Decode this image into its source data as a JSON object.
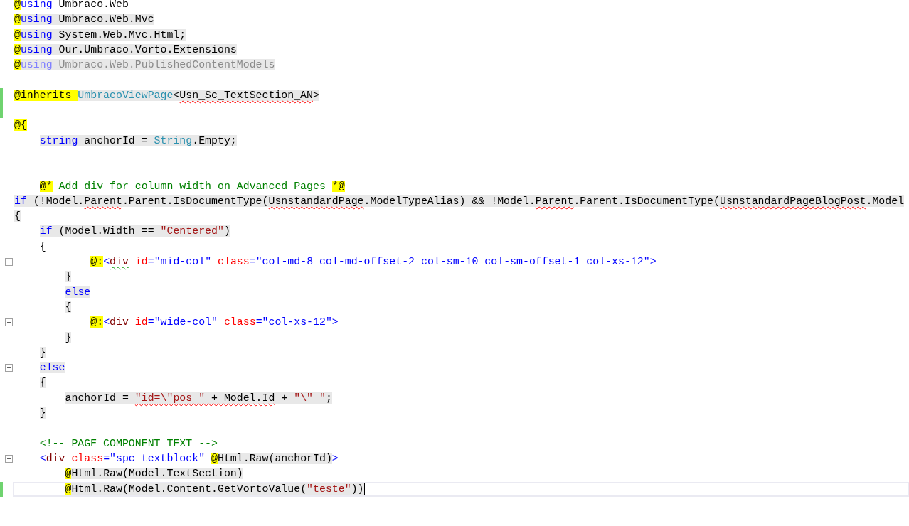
{
  "editor": {
    "lines": [
      {
        "kind": "code",
        "tokens": [
          {
            "kind": "razor",
            "text": "@"
          },
          {
            "kind": "keyword",
            "text": "using"
          },
          {
            "kind": "plain",
            "text": " Umbraco.Web"
          }
        ]
      },
      {
        "kind": "code",
        "tokens": [
          {
            "kind": "razor",
            "text": "@"
          },
          {
            "kind": "keyword",
            "text": "using",
            "hl": true
          },
          {
            "kind": "plain",
            "text": " Umbraco.Web.Mvc",
            "hl": true
          }
        ]
      },
      {
        "kind": "code",
        "tokens": [
          {
            "kind": "razor",
            "text": "@"
          },
          {
            "kind": "keyword",
            "text": "using",
            "hl": true
          },
          {
            "kind": "plain",
            "text": " System.Web.Mvc.Html;",
            "hl": true
          }
        ]
      },
      {
        "kind": "code",
        "tokens": [
          {
            "kind": "razor",
            "text": "@"
          },
          {
            "kind": "keyword",
            "text": "using",
            "hl": true
          },
          {
            "kind": "plain",
            "text": " Our.Umbraco.Vorto.Extensions",
            "hl": true
          }
        ]
      },
      {
        "kind": "code",
        "tokens": [
          {
            "kind": "razor",
            "text": "@"
          },
          {
            "kind": "fadedkeyword",
            "text": "using",
            "hl": true
          },
          {
            "kind": "faded",
            "text": " Umbraco.Web.PublishedContentModels",
            "hl": true
          }
        ]
      },
      {
        "kind": "blank"
      },
      {
        "kind": "code",
        "changed": true,
        "tokens": [
          {
            "kind": "razor",
            "text": "@inherits "
          },
          {
            "kind": "type",
            "text": "UmbracoViewPage",
            "hl": true
          },
          {
            "kind": "plain",
            "text": "<",
            "hl": true
          },
          {
            "kind": "plain",
            "text": "Usn_Sc_TextSection_AN",
            "hl": true,
            "error": true
          },
          {
            "kind": "plain",
            "text": ">",
            "hl": true
          }
        ]
      },
      {
        "kind": "blank",
        "changed": true
      },
      {
        "kind": "code",
        "tokens": [
          {
            "kind": "razor",
            "text": "@{"
          }
        ]
      },
      {
        "kind": "code",
        "tokens": [
          {
            "kind": "keyword",
            "text": "    string",
            "hl": true
          },
          {
            "kind": "plain",
            "text": " anchorId = ",
            "hl": true
          },
          {
            "kind": "type",
            "text": "String",
            "hl": true
          },
          {
            "kind": "plain",
            "text": ".Empty;",
            "hl": true
          }
        ]
      },
      {
        "kind": "blank"
      },
      {
        "kind": "blank"
      },
      {
        "kind": "code",
        "tokens": [
          {
            "kind": "razor",
            "text": "    @*"
          },
          {
            "kind": "comment",
            "text": " Add div for column width on Advanced Pages "
          },
          {
            "kind": "razor",
            "text": "*@"
          }
        ]
      },
      {
        "kind": "code",
        "tokens": [
          {
            "kind": "keyword",
            "text": "if",
            "hl": true
          },
          {
            "kind": "plain",
            "text": " (!Model.",
            "hl": true
          },
          {
            "kind": "plain",
            "text": "Parent",
            "hl": true,
            "error": true
          },
          {
            "kind": "plain",
            "text": ".Parent.IsDocumentType(",
            "hl": true
          },
          {
            "kind": "plain",
            "text": "UsnstandardPage",
            "hl": true,
            "error": true
          },
          {
            "kind": "plain",
            "text": ".ModelTypeAlias) && !Model.",
            "hl": true
          },
          {
            "kind": "plain",
            "text": "Parent",
            "hl": true,
            "error": true
          },
          {
            "kind": "plain",
            "text": ".Parent.IsDocumentType(",
            "hl": true
          },
          {
            "kind": "plain",
            "text": "UsnstandardPageBlogPost",
            "hl": true,
            "error": true
          },
          {
            "kind": "plain",
            "text": ".Model",
            "hl": true
          }
        ]
      },
      {
        "kind": "code",
        "tokens": [
          {
            "kind": "plain",
            "text": "{",
            "hl": true
          }
        ]
      },
      {
        "kind": "code",
        "tokens": [
          {
            "kind": "keyword",
            "text": "    if",
            "hl": true
          },
          {
            "kind": "plain",
            "text": " (Model.Width == ",
            "hl": true
          },
          {
            "kind": "string",
            "text": "\"Centered\"",
            "hl": true
          },
          {
            "kind": "plain",
            "text": ")",
            "hl": true
          }
        ]
      },
      {
        "kind": "code",
        "tokens": [
          {
            "kind": "plain",
            "text": "    {"
          }
        ]
      },
      {
        "kind": "code",
        "fold": true,
        "tokens": [
          {
            "kind": "razor",
            "text": "            @:"
          },
          {
            "kind": "tag",
            "text": "<"
          },
          {
            "kind": "element",
            "text": "div",
            "warning": true
          },
          {
            "kind": "attr",
            "text": " id"
          },
          {
            "kind": "tag",
            "text": "="
          },
          {
            "kind": "tag",
            "text": "\"mid-col\""
          },
          {
            "kind": "attr",
            "text": " class"
          },
          {
            "kind": "tag",
            "text": "="
          },
          {
            "kind": "tag",
            "text": "\"col-md-8 col-md-offset-2 col-sm-10 col-sm-offset-1 col-xs-12\""
          },
          {
            "kind": "tag",
            "text": ">"
          }
        ]
      },
      {
        "kind": "code",
        "tokens": [
          {
            "kind": "plain",
            "text": "        }",
            "hl": true
          }
        ]
      },
      {
        "kind": "code",
        "tokens": [
          {
            "kind": "keyword",
            "text": "        else",
            "hl": true
          }
        ]
      },
      {
        "kind": "code",
        "tokens": [
          {
            "kind": "plain",
            "text": "        {",
            "hl": true
          }
        ]
      },
      {
        "kind": "code",
        "fold": true,
        "tokens": [
          {
            "kind": "razor",
            "text": "            @:"
          },
          {
            "kind": "tag",
            "text": "<"
          },
          {
            "kind": "element",
            "text": "div"
          },
          {
            "kind": "attr",
            "text": " id"
          },
          {
            "kind": "tag",
            "text": "="
          },
          {
            "kind": "tag",
            "text": "\"wide-col\""
          },
          {
            "kind": "attr",
            "text": " class"
          },
          {
            "kind": "tag",
            "text": "="
          },
          {
            "kind": "tag",
            "text": "\"col-xs-12\""
          },
          {
            "kind": "tag",
            "text": ">"
          }
        ]
      },
      {
        "kind": "code",
        "tokens": [
          {
            "kind": "plain",
            "text": "        }",
            "hl": true
          }
        ]
      },
      {
        "kind": "code",
        "tokens": [
          {
            "kind": "plain",
            "text": "    }",
            "hl": true
          }
        ]
      },
      {
        "kind": "code",
        "fold": true,
        "tokens": [
          {
            "kind": "keyword",
            "text": "    else",
            "hl": true
          }
        ]
      },
      {
        "kind": "code",
        "tokens": [
          {
            "kind": "plain",
            "text": "    {",
            "hl": true
          }
        ]
      },
      {
        "kind": "code",
        "tokens": [
          {
            "kind": "plain",
            "text": "        anchorId = ",
            "hl": true
          },
          {
            "kind": "string",
            "text": "\"id=\\\"pos_\"",
            "hl": true,
            "error": true
          },
          {
            "kind": "plain",
            "text": " + Model.Id",
            "hl": true,
            "error": true
          },
          {
            "kind": "plain",
            "text": " + ",
            "hl": true
          },
          {
            "kind": "string",
            "text": "\"\\\" \"",
            "hl": true
          },
          {
            "kind": "plain",
            "text": ";",
            "hl": true
          }
        ]
      },
      {
        "kind": "code",
        "tokens": [
          {
            "kind": "plain",
            "text": "    }",
            "hl": true
          }
        ]
      },
      {
        "kind": "blank"
      },
      {
        "kind": "code",
        "tokens": [
          {
            "kind": "comment",
            "text": "    <!-- PAGE COMPONENT TEXT -->"
          }
        ]
      },
      {
        "kind": "code",
        "fold": true,
        "tokens": [
          {
            "kind": "tag",
            "text": "    <"
          },
          {
            "kind": "element",
            "text": "div"
          },
          {
            "kind": "attr",
            "text": " class"
          },
          {
            "kind": "tag",
            "text": "="
          },
          {
            "kind": "tag",
            "text": "\"spc textblock\" "
          },
          {
            "kind": "razor",
            "text": "@"
          },
          {
            "kind": "plain",
            "text": "Html.Raw(anchorId)",
            "hl": true
          },
          {
            "kind": "tag",
            "text": ">"
          }
        ]
      },
      {
        "kind": "code",
        "tokens": [
          {
            "kind": "razor",
            "text": "        @"
          },
          {
            "kind": "plain",
            "text": "Html.Raw(Model.TextSection)",
            "hl": true
          }
        ]
      },
      {
        "kind": "code",
        "changed": true,
        "current": true,
        "tokens": [
          {
            "kind": "razor",
            "text": "        @"
          },
          {
            "kind": "plain",
            "text": "Html.Raw(Model.Content.GetVortoValue(",
            "hl": true
          },
          {
            "kind": "string",
            "text": "\"teste\"",
            "hl": true
          },
          {
            "kind": "plain",
            "text": "))",
            "hl": true
          }
        ]
      }
    ]
  }
}
